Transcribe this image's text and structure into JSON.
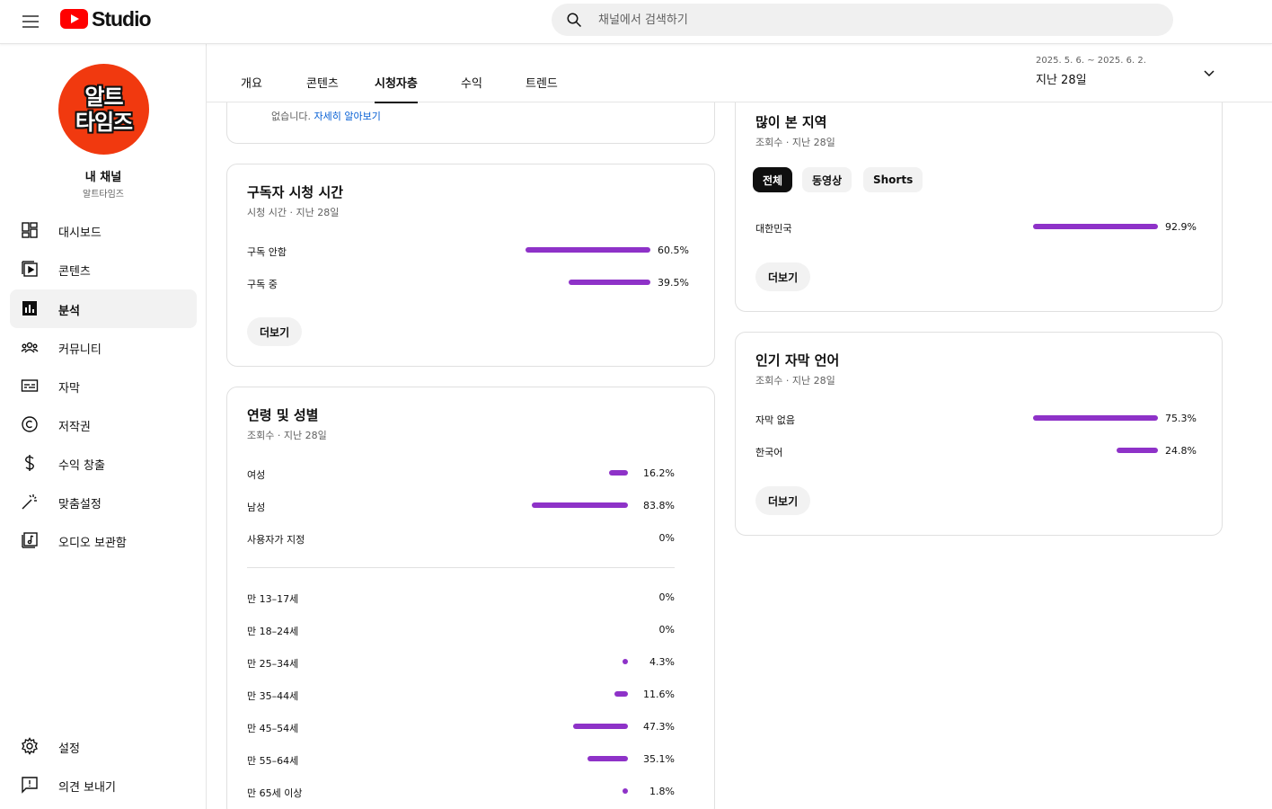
{
  "app": {
    "logo_text": "Studio"
  },
  "search": {
    "placeholder": "채널에서 검색하기"
  },
  "channel": {
    "avatar_line1": "알트",
    "avatar_line2": "타임즈",
    "title": "내 채널",
    "name": "알트타임즈"
  },
  "sidebar": {
    "items": [
      {
        "label": "대시보드",
        "icon": "dashboard-icon"
      },
      {
        "label": "콘텐츠",
        "icon": "content-icon"
      },
      {
        "label": "분석",
        "icon": "analytics-icon",
        "active": true
      },
      {
        "label": "커뮤니티",
        "icon": "community-icon"
      },
      {
        "label": "자막",
        "icon": "subtitles-icon"
      },
      {
        "label": "저작권",
        "icon": "copyright-icon"
      },
      {
        "label": "수익 창출",
        "icon": "dollar-icon"
      },
      {
        "label": "맞춤설정",
        "icon": "wand-icon"
      },
      {
        "label": "오디오 보관함",
        "icon": "audio-library-icon"
      }
    ],
    "bottom": [
      {
        "label": "설정",
        "icon": "gear-icon"
      },
      {
        "label": "의견 보내기",
        "icon": "feedback-icon"
      }
    ]
  },
  "tabs": [
    {
      "label": "개요"
    },
    {
      "label": "콘텐츠"
    },
    {
      "label": "시청자층",
      "active": true
    },
    {
      "label": "수익"
    },
    {
      "label": "트렌드"
    }
  ],
  "date": {
    "range": "2025. 5. 6. ~ 2025. 6. 2.",
    "label": "지난 28일"
  },
  "partial_card": {
    "text": "없습니다.",
    "link": "자세히 알아보기"
  },
  "subscriber_watch": {
    "title": "구독자 시청 시간",
    "subtitle": "시청 시간 · 지난 28일",
    "rows": [
      {
        "label": "구독 안함",
        "value": "60.5%",
        "pct": 60.5
      },
      {
        "label": "구독 중",
        "value": "39.5%",
        "pct": 39.5
      }
    ],
    "more": "더보기"
  },
  "age_gender": {
    "title": "연령 및 성별",
    "subtitle": "조회수 · 지난 28일",
    "gender_rows": [
      {
        "label": "여성",
        "value": "16.2%",
        "pct": 16.2
      },
      {
        "label": "남성",
        "value": "83.8%",
        "pct": 83.8
      },
      {
        "label": "사용자가 지정",
        "value": "0%",
        "pct": 0
      }
    ],
    "age_rows": [
      {
        "label": "만 13–17세",
        "value": "0%",
        "pct": 0
      },
      {
        "label": "만 18–24세",
        "value": "0%",
        "pct": 0
      },
      {
        "label": "만 25–34세",
        "value": "4.3%",
        "pct": 4.3
      },
      {
        "label": "만 35–44세",
        "value": "11.6%",
        "pct": 11.6
      },
      {
        "label": "만 45–54세",
        "value": "47.3%",
        "pct": 47.3
      },
      {
        "label": "만 55–64세",
        "value": "35.1%",
        "pct": 35.1
      },
      {
        "label": "만 65세 이상",
        "value": "1.8%",
        "pct": 1.8
      }
    ]
  },
  "top_regions": {
    "title": "많이 본 지역",
    "subtitle": "조회수 · 지난 28일",
    "chips": [
      {
        "label": "전체",
        "active": true
      },
      {
        "label": "동영상"
      },
      {
        "label": "Shorts"
      }
    ],
    "rows": [
      {
        "label": "대한민국",
        "value": "92.9%",
        "pct": 92.9
      }
    ],
    "more": "더보기"
  },
  "subtitle_languages": {
    "title": "인기 자막 언어",
    "subtitle": "조회수 · 지난 28일",
    "rows": [
      {
        "label": "자막 없음",
        "value": "75.3%",
        "pct": 75.3
      },
      {
        "label": "한국어",
        "value": "24.8%",
        "pct": 24.8
      }
    ],
    "more": "더보기"
  },
  "colors": {
    "bar": "#8e32c8",
    "brand": "#ff0000",
    "link": "#065fd4"
  }
}
